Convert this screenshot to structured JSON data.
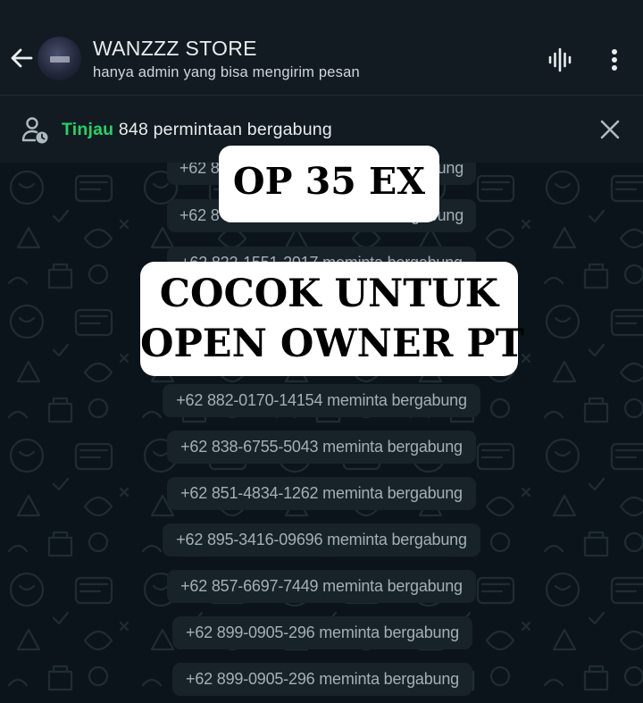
{
  "header": {
    "title": "WANZZZ STORE",
    "subtitle": "hanya admin yang bisa mengirim pesan"
  },
  "banner": {
    "link": "Tinjau",
    "text": " 848 permintaan bergabung"
  },
  "overlay": {
    "top": "OP 35 EX",
    "line1": "COCOK UNTUK",
    "line2": "OPEN OWNER PT"
  },
  "messages": [
    "+62 8",
    "bergabung",
    "+62 8",
    "bergabung",
    "+62 822-1551-2017 meminta bergabung",
    "+62 882-0170-14154 meminta bergabung",
    "+62 838-6755-5043 meminta bergabung",
    "+62 851-4834-1262 meminta bergabung",
    "+62 895-3416-09696 meminta bergabung",
    "+62 857-6697-7449 meminta bergabung",
    "+62 899-0905-296 meminta bergabung",
    "+62 899-0905-296 meminta bergabung"
  ],
  "colors": {
    "accent": "#25d366",
    "background": "#0b141a",
    "header": "#111b21",
    "bubble": "#182229"
  },
  "icons": [
    "back-arrow-icon",
    "voice-chat-icon",
    "more-options-icon",
    "pending-user-icon",
    "close-icon"
  ]
}
